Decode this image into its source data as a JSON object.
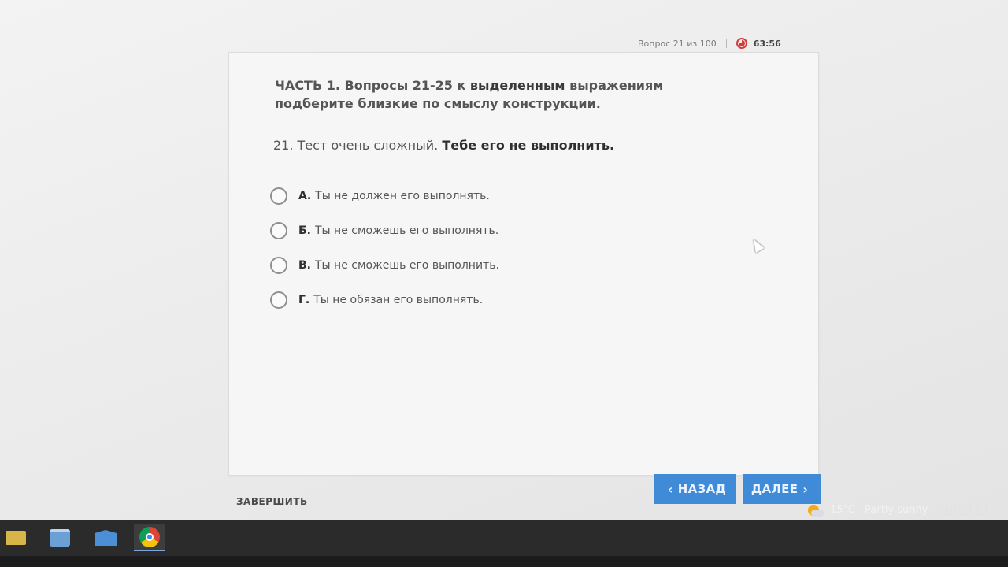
{
  "status": {
    "question_counter": "Вопрос 21 из 100",
    "timer": "63:56"
  },
  "instruction": {
    "part1": "ЧАСТЬ 1. Вопросы 21-25 к ",
    "underlined": "выделенным",
    "part2": " выражениям подберите близкие по смыслу конструкции."
  },
  "question": {
    "prefix": "21. Тест очень сложный. ",
    "bold": "Тебе его не выполнить."
  },
  "options": [
    {
      "letter": "А.",
      "text": "Ты не должен его выполнять."
    },
    {
      "letter": "Б.",
      "text": "Ты не сможешь его выполнять."
    },
    {
      "letter": "В.",
      "text": "Ты не сможешь его выполнить."
    },
    {
      "letter": "Г.",
      "text": "Ты не обязан его выполнять."
    }
  ],
  "buttons": {
    "finish": "ЗАВЕРШИТЬ",
    "back": "НАЗАД",
    "next": "ДАЛЕЕ",
    "back_chevron": "‹",
    "next_chevron": "›"
  },
  "taskbar": {
    "weather_temp": "15°C",
    "weather_text": "Partly sunny",
    "tray_chevron": "^",
    "apps": [
      "files-icon",
      "store-icon",
      "mail-icon",
      "chrome-icon"
    ]
  },
  "colors": {
    "accent_button": "#3f8bd8",
    "timer_red": "#d23c3c",
    "taskbar": "#2b2b2b"
  }
}
